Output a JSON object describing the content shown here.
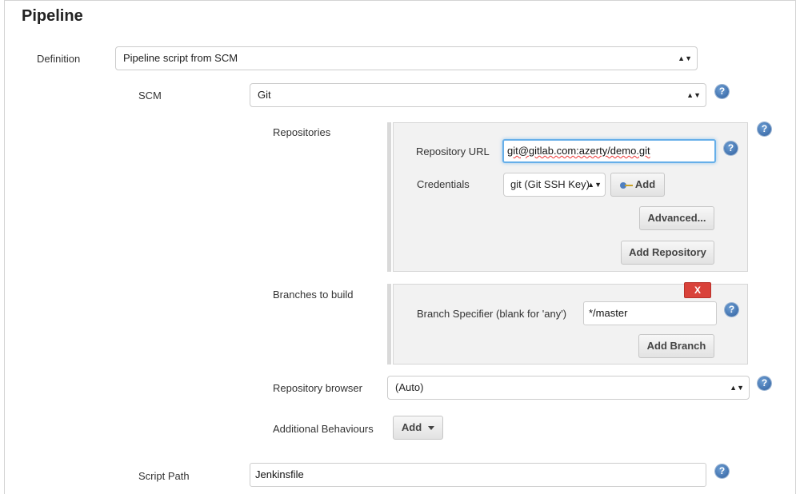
{
  "section": {
    "title": "Pipeline"
  },
  "definition": {
    "label": "Definition",
    "value": "Pipeline script from SCM"
  },
  "scm": {
    "label": "SCM",
    "value": "Git"
  },
  "repositories": {
    "label": "Repositories",
    "url_label": "Repository URL",
    "url_value": "git@gitlab.com:azerty/demo.git",
    "credentials_label": "Credentials",
    "credentials_value": "git (Git SSH Key)",
    "add_label": "Add",
    "advanced_label": "Advanced...",
    "add_repository_label": "Add Repository"
  },
  "branches": {
    "label": "Branches to build",
    "delete_label": "X",
    "specifier_label": "Branch Specifier (blank for 'any')",
    "specifier_value": "*/master",
    "add_branch_label": "Add Branch"
  },
  "repo_browser": {
    "label": "Repository browser",
    "value": "(Auto)"
  },
  "behaviours": {
    "label": "Additional Behaviours",
    "add_label": "Add"
  },
  "script_path": {
    "label": "Script Path",
    "value": "Jenkinsfile"
  },
  "help_glyph": "?",
  "select_arrows": "▲▼",
  "icons": {
    "help": "help-icon",
    "select": "select-arrows-icon",
    "key": "key-icon",
    "caret": "caret-down-icon"
  },
  "colors": {
    "focus_border": "#66afe9",
    "help_blue": "#2f5f9e",
    "delete_red": "#d9423a",
    "panel_bg": "#f2f2f2"
  }
}
